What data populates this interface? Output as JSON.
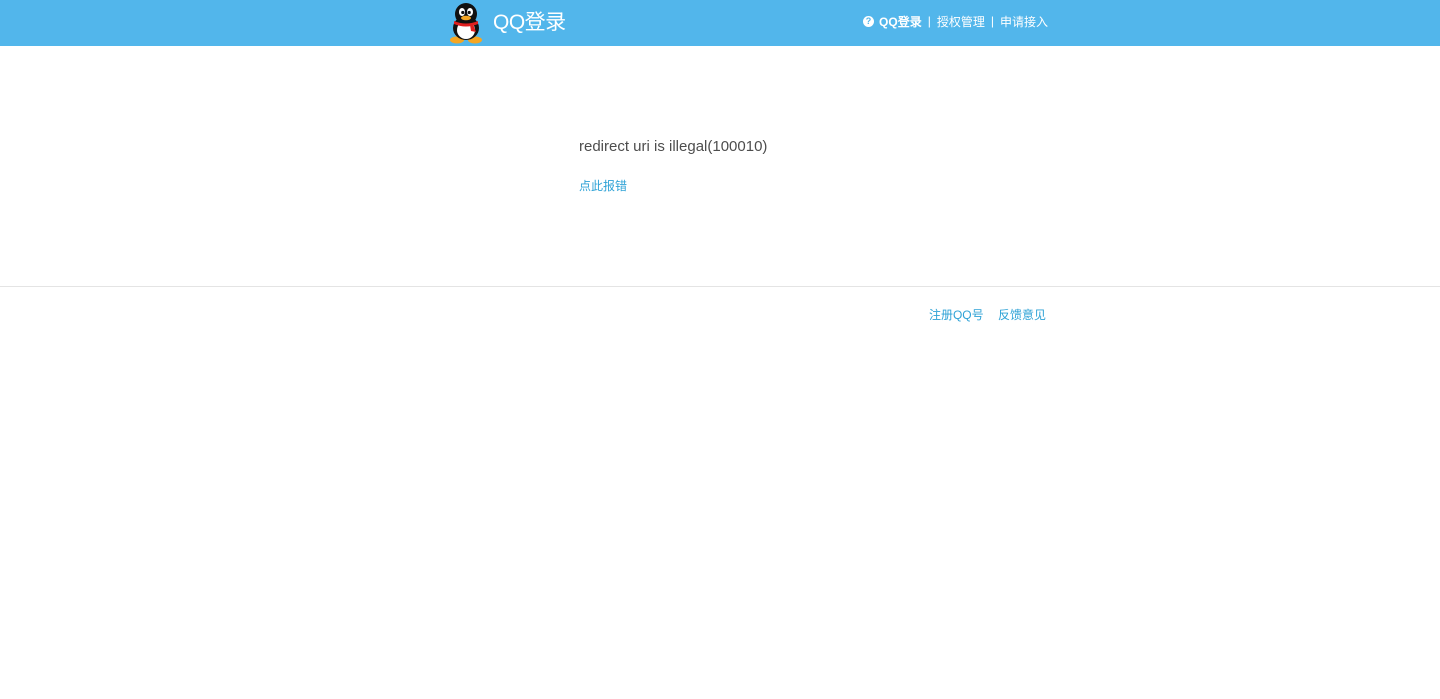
{
  "header": {
    "brand_title": "QQ登录",
    "logo_icon": "qq-penguin-icon",
    "help_icon": "question-circle-icon",
    "nav": {
      "qq_login": "QQ登录",
      "auth_manage": "授权管理",
      "apply_access": "申请接入",
      "separator": "|"
    },
    "bg_color": "#52b6eb"
  },
  "main": {
    "error_message": "redirect uri is illegal(100010)",
    "report_link": "点此报错"
  },
  "footer": {
    "register_link": "注册QQ号",
    "feedback_link": "反馈意见"
  },
  "colors": {
    "link": "#2ea2d6",
    "text": "#4d4d4d"
  }
}
